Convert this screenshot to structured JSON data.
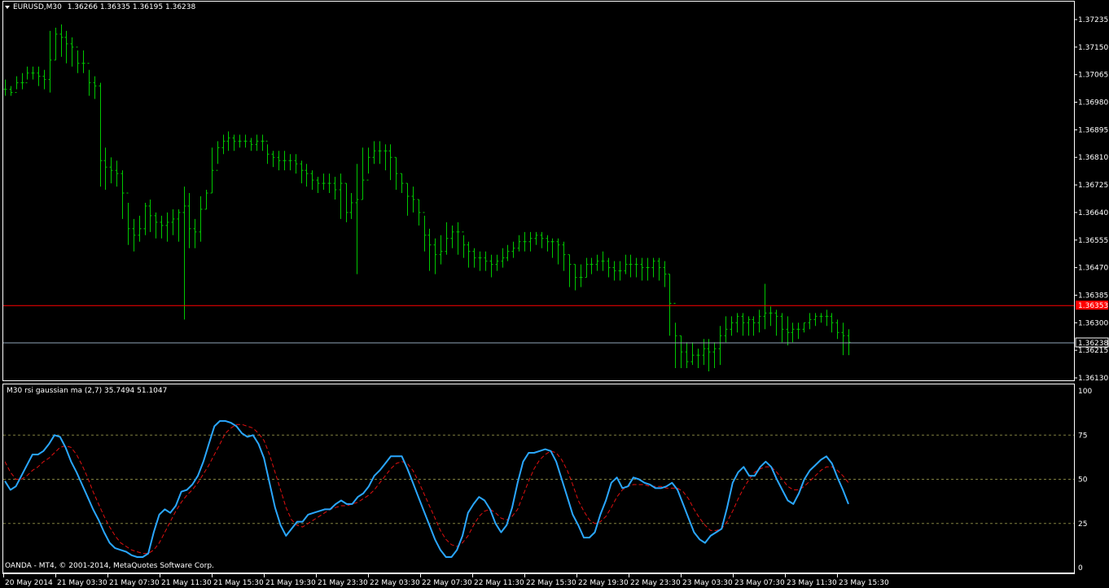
{
  "header": {
    "symbol": "EURUSD,M30",
    "open": "1.36266",
    "high": "1.36335",
    "low": "1.36195",
    "close": "1.36238"
  },
  "indicator": {
    "title": "M30  rsi gaussian ma (2,7) 35.7494 51.1047"
  },
  "copyright": "OANDA - MT4, © 2001-2014, MetaQuotes Software Corp.",
  "colors": {
    "background": "#000000",
    "border": "#ffffff",
    "bars": "#00c800",
    "price_line_red": "#ff0000",
    "bid_line": "#8fa3b8",
    "rsi": "#2aa7ff",
    "signal": "#e01010",
    "levels": "#808040"
  },
  "price_axis": {
    "ticks": [
      "1.37235",
      "1.37150",
      "1.37065",
      "1.36980",
      "1.36895",
      "1.36810",
      "1.36725",
      "1.36640",
      "1.36555",
      "1.36470",
      "1.36385",
      "1.36300",
      "1.36215",
      "1.36130"
    ],
    "red_level": 1.36353,
    "red_level_label": "1.36353",
    "bid_level": 1.36238,
    "bid_level_label": "1.36238"
  },
  "indicator_axis": {
    "ticks": [
      "100",
      "75",
      "50",
      "25",
      "0"
    ],
    "levels": [
      75,
      50,
      25
    ]
  },
  "time_axis": {
    "labels": [
      "20 May 2014",
      "21 May 03:30",
      "21 May 07:30",
      "21 May 11:30",
      "21 May 15:30",
      "21 May 19:30",
      "21 May 23:30",
      "22 May 03:30",
      "22 May 07:30",
      "22 May 11:30",
      "22 May 15:30",
      "22 May 19:30",
      "22 May 23:30",
      "23 May 03:30",
      "23 May 07:30",
      "23 May 11:30",
      "23 May 15:30"
    ]
  },
  "chart_data": [
    {
      "type": "line",
      "name": "EURUSD,M30",
      "ylim": [
        1.3611,
        1.3728
      ],
      "y": [
        1.3702,
        1.3701,
        1.3704,
        1.3704,
        1.3707,
        1.3707,
        1.3706,
        1.3705,
        1.3711,
        1.3719,
        1.3718,
        1.3716,
        1.3715,
        1.371,
        1.371,
        1.3704,
        1.3703,
        1.368,
        1.3678,
        1.3677,
        1.3676,
        1.367,
        1.3659,
        1.3657,
        1.3659,
        1.3666,
        1.3663,
        1.3661,
        1.366,
        1.3661,
        1.3662,
        1.3664,
        1.3666,
        1.3659,
        1.3658,
        1.3665,
        1.367,
        1.3677,
        1.3684,
        1.3686,
        1.3687,
        1.3686,
        1.3686,
        1.3686,
        1.3685,
        1.3686,
        1.3686,
        1.3682,
        1.3681,
        1.368,
        1.368,
        1.368,
        1.3679,
        1.3677,
        1.3676,
        1.3674,
        1.3673,
        1.3673,
        1.3673,
        1.3671,
        1.3673,
        1.3664,
        1.3667,
        1.3668,
        1.3674,
        1.3681,
        1.3683,
        1.3683,
        1.3683,
        1.3681,
        1.3676,
        1.3673,
        1.3669,
        1.3668,
        1.3664,
        1.3657,
        1.3654,
        1.3651,
        1.3652,
        1.3656,
        1.3658,
        1.3658,
        1.3654,
        1.3652,
        1.365,
        1.365,
        1.3649,
        1.3648,
        1.3649,
        1.365,
        1.3652,
        1.3653,
        1.3655,
        1.3655,
        1.3656,
        1.3657,
        1.3656,
        1.3655,
        1.3655,
        1.3654,
        1.3651,
        1.3648,
        1.3644,
        1.3644,
        1.3648,
        1.3648,
        1.3649,
        1.3649,
        1.3647,
        1.3646,
        1.3646,
        1.3648,
        1.3648,
        1.3648,
        1.3647,
        1.3647,
        1.3649,
        1.3647,
        1.3645,
        1.3636,
        1.3626,
        1.3621,
        1.3618,
        1.362,
        1.362,
        1.3622,
        1.3621,
        1.3622,
        1.3626,
        1.3628,
        1.363,
        1.3632,
        1.363,
        1.3631,
        1.363,
        1.3632,
        1.3633,
        1.3633,
        1.3632,
        1.3628,
        1.3627,
        1.3628,
        1.3628,
        1.363,
        1.3631,
        1.3632,
        1.3632,
        1.3632,
        1.363,
        1.3627,
        1.3626,
        1.3624
      ],
      "low": [
        1.37,
        1.37,
        1.3702,
        1.3702,
        1.3705,
        1.3705,
        1.3703,
        1.3702,
        1.3701,
        1.3711,
        1.3712,
        1.371,
        1.3709,
        1.3707,
        1.3707,
        1.37,
        1.3699,
        1.3672,
        1.3671,
        1.3673,
        1.3672,
        1.3662,
        1.3654,
        1.3652,
        1.3655,
        1.3657,
        1.3658,
        1.3656,
        1.3656,
        1.3655,
        1.3657,
        1.3655,
        1.3631,
        1.3653,
        1.3653,
        1.3655,
        1.3665,
        1.367,
        1.3679,
        1.3682,
        1.3683,
        1.3683,
        1.3684,
        1.3684,
        1.3683,
        1.3683,
        1.3683,
        1.3679,
        1.3678,
        1.3677,
        1.3677,
        1.3677,
        1.3676,
        1.3673,
        1.3672,
        1.3671,
        1.367,
        1.3671,
        1.367,
        1.3668,
        1.3662,
        1.3661,
        1.3662,
        1.3645,
        1.3668,
        1.3676,
        1.3679,
        1.3679,
        1.3677,
        1.3674,
        1.3671,
        1.367,
        1.3663,
        1.3664,
        1.366,
        1.3652,
        1.3646,
        1.3645,
        1.3648,
        1.3651,
        1.3653,
        1.3651,
        1.365,
        1.3647,
        1.3647,
        1.3646,
        1.3646,
        1.3644,
        1.3646,
        1.3647,
        1.3649,
        1.365,
        1.3652,
        1.3652,
        1.3652,
        1.3654,
        1.3653,
        1.3652,
        1.365,
        1.3648,
        1.3646,
        1.3641,
        1.364,
        1.3641,
        1.3644,
        1.3645,
        1.3646,
        1.3646,
        1.3644,
        1.3643,
        1.3643,
        1.3645,
        1.3644,
        1.3644,
        1.3643,
        1.3643,
        1.3644,
        1.3643,
        1.3641,
        1.3626,
        1.3616,
        1.3616,
        1.3616,
        1.3617,
        1.3616,
        1.3617,
        1.3615,
        1.3616,
        1.3617,
        1.3624,
        1.3626,
        1.3627,
        1.3626,
        1.3626,
        1.3626,
        1.3627,
        1.3628,
        1.3629,
        1.3626,
        1.3624,
        1.3623,
        1.3624,
        1.3625,
        1.3627,
        1.3628,
        1.3629,
        1.363,
        1.3629,
        1.3627,
        1.3625,
        1.362,
        1.362
      ],
      "high": [
        1.3705,
        1.3703,
        1.3706,
        1.3707,
        1.3709,
        1.3709,
        1.3709,
        1.3708,
        1.372,
        1.3721,
        1.3722,
        1.372,
        1.3718,
        1.3714,
        1.3714,
        1.3708,
        1.3706,
        1.3704,
        1.3684,
        1.3681,
        1.368,
        1.3677,
        1.3667,
        1.3662,
        1.3663,
        1.3667,
        1.3668,
        1.3664,
        1.3663,
        1.3664,
        1.3665,
        1.3665,
        1.3672,
        1.367,
        1.3662,
        1.3669,
        1.3671,
        1.3684,
        1.3686,
        1.3688,
        1.3689,
        1.3688,
        1.3688,
        1.3688,
        1.3687,
        1.3688,
        1.3688,
        1.3685,
        1.3683,
        1.3683,
        1.3683,
        1.3682,
        1.3682,
        1.368,
        1.3679,
        1.3677,
        1.3675,
        1.3676,
        1.3676,
        1.3675,
        1.3676,
        1.3673,
        1.367,
        1.3679,
        1.3684,
        1.3684,
        1.3686,
        1.3686,
        1.3685,
        1.3685,
        1.3681,
        1.3676,
        1.3673,
        1.3672,
        1.3668,
        1.3663,
        1.3659,
        1.3656,
        1.3657,
        1.3661,
        1.366,
        1.3661,
        1.3657,
        1.3655,
        1.3653,
        1.3652,
        1.3652,
        1.3651,
        1.3651,
        1.3653,
        1.3654,
        1.3655,
        1.3657,
        1.3658,
        1.3658,
        1.3658,
        1.3658,
        1.3657,
        1.3656,
        1.3656,
        1.3655,
        1.3651,
        1.3648,
        1.3648,
        1.365,
        1.365,
        1.3651,
        1.3652,
        1.365,
        1.3649,
        1.3649,
        1.3651,
        1.3651,
        1.365,
        1.365,
        1.365,
        1.365,
        1.365,
        1.3649,
        1.3645,
        1.363,
        1.3626,
        1.3624,
        1.3624,
        1.3622,
        1.3625,
        1.3625,
        1.3624,
        1.3629,
        1.3632,
        1.3632,
        1.3633,
        1.3633,
        1.3632,
        1.3632,
        1.3634,
        1.3642,
        1.3635,
        1.3634,
        1.3633,
        1.3632,
        1.363,
        1.363,
        1.363,
        1.3633,
        1.3633,
        1.3633,
        1.3634,
        1.3633,
        1.3631,
        1.363,
        1.3628,
        1.3627
      ]
    },
    {
      "type": "line",
      "ylim": [
        0,
        100
      ],
      "series": [
        {
          "y": [
            49,
            44,
            46,
            52,
            58,
            64,
            64,
            66,
            70,
            75,
            74,
            68,
            60,
            54,
            47,
            40,
            33,
            27,
            20,
            14,
            11,
            10,
            9,
            7,
            6,
            6,
            8,
            20,
            30,
            33,
            31,
            35,
            43,
            44,
            47,
            52,
            60,
            70,
            80,
            83,
            83,
            82,
            80,
            76,
            74,
            75,
            70,
            62,
            48,
            34,
            24,
            18,
            22,
            26,
            26,
            30,
            31,
            32,
            33,
            33,
            36,
            38,
            36,
            36,
            40,
            42,
            46,
            52,
            55,
            59,
            63,
            63,
            63,
            56,
            48,
            40,
            32,
            24,
            16,
            10,
            6,
            6,
            10,
            18,
            31,
            36,
            40,
            38,
            33,
            25,
            20,
            24,
            34,
            48,
            60,
            65,
            65,
            66,
            67,
            66,
            60,
            50,
            40,
            30,
            24,
            17,
            17,
            20,
            30,
            38,
            48,
            51,
            45,
            46,
            51,
            50,
            48,
            47,
            45,
            45,
            46,
            48,
            44,
            36,
            28,
            20,
            16,
            14,
            18,
            20,
            22,
            34,
            48,
            54,
            57,
            52,
            52,
            57,
            60,
            57,
            50,
            44,
            38,
            36,
            42,
            50,
            55,
            58,
            61,
            63,
            59,
            51,
            44,
            36
          ]
        },
        {
          "y": [
            60,
            54,
            50,
            50,
            52,
            55,
            57,
            60,
            62,
            65,
            68,
            69,
            68,
            64,
            58,
            51,
            43,
            36,
            29,
            23,
            18,
            14,
            12,
            10,
            9,
            8,
            8,
            10,
            14,
            20,
            26,
            32,
            37,
            41,
            44,
            48,
            53,
            58,
            64,
            70,
            76,
            79,
            81,
            81,
            80,
            79,
            76,
            72,
            64,
            54,
            44,
            34,
            27,
            24,
            23,
            25,
            27,
            29,
            31,
            33,
            34,
            35,
            35,
            36,
            37,
            39,
            41,
            44,
            48,
            52,
            56,
            59,
            60,
            59,
            55,
            49,
            42,
            35,
            28,
            21,
            16,
            13,
            12,
            14,
            18,
            24,
            29,
            32,
            33,
            31,
            28,
            27,
            29,
            33,
            41,
            49,
            56,
            61,
            64,
            66,
            65,
            61,
            55,
            47,
            38,
            32,
            27,
            25,
            26,
            29,
            34,
            40,
            44,
            46,
            47,
            47,
            47,
            46,
            46,
            46,
            45,
            45,
            45,
            43,
            39,
            33,
            28,
            24,
            21,
            21,
            22,
            26,
            32,
            39,
            45,
            50,
            54,
            56,
            57,
            57,
            54,
            50,
            46,
            44,
            44,
            46,
            49,
            52,
            55,
            57,
            57,
            55,
            52,
            48
          ]
        }
      ]
    }
  ]
}
